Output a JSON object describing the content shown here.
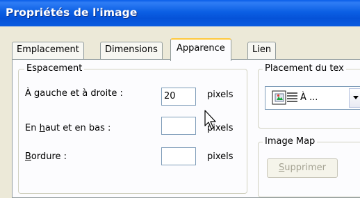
{
  "window": {
    "title": "Propriétés de l'image"
  },
  "tabs": [
    {
      "label": "Emplacement",
      "active": false
    },
    {
      "label": "Dimensions",
      "active": false
    },
    {
      "label": "Apparence",
      "active": true
    },
    {
      "label": "Lien",
      "active": false
    }
  ],
  "spacing": {
    "legend": "Espacement",
    "horizontal": {
      "label_pre": "À ",
      "label_key": "g",
      "label_post": "auche et à droite :",
      "value": "20",
      "unit": "pixels"
    },
    "vertical": {
      "label_pre": "En ",
      "label_key": "h",
      "label_post": "aut et en bas :",
      "value": "",
      "unit": "pixels"
    },
    "border": {
      "label_pre": "",
      "label_key": "B",
      "label_post": "ordure :",
      "value": "",
      "unit": "pixels"
    }
  },
  "text_placement": {
    "legend": "Placement du tex",
    "selected": "À ...",
    "icon": "wrap-right-icon"
  },
  "image_map": {
    "legend": "Image Map",
    "remove_key": "S",
    "remove_rest": "upprimer",
    "remove_enabled": false
  },
  "colors": {
    "title_bar": "#0a5ee8",
    "active_tab_highlight": "#ffc83c",
    "dialog_bg": "#ece9d8"
  }
}
